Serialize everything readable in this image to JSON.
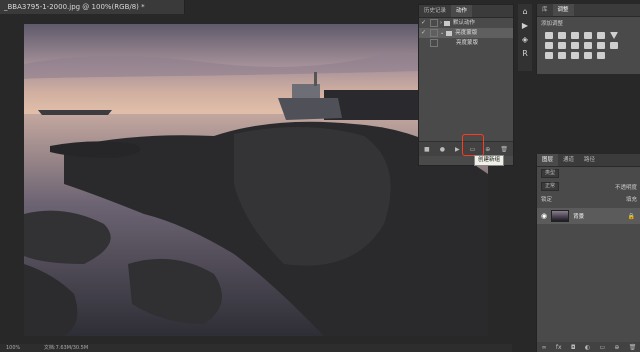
{
  "document": {
    "tab_title": "_BBA3795-1-2000.jpg @ 100%(RGB/8) *",
    "status_text": "文档:7.63M/30.5M",
    "zoom": "100%"
  },
  "actions_panel": {
    "tabs": [
      "历史记录",
      "动作"
    ],
    "active_tab": "动作",
    "rows": [
      {
        "check": "✓",
        "label": "默认动作",
        "selected": false,
        "indent": 0
      },
      {
        "check": "✓",
        "label": "亮度蒙版",
        "selected": true,
        "indent": 1
      },
      {
        "check": "",
        "label": "亮度蒙版",
        "selected": false,
        "indent": 2
      }
    ],
    "toolbar_icons": [
      "stop-icon",
      "record-icon",
      "play-icon",
      "new-set-icon",
      "new-action-icon",
      "delete-icon"
    ],
    "tooltip": "创建新组"
  },
  "right_panel": {
    "tabs": [
      "库",
      "调整"
    ],
    "active_tab": "调整",
    "adj_label": "添加调整"
  },
  "layers_panel": {
    "tabs": [
      "图层",
      "通道",
      "路径"
    ],
    "active_tab": "图层",
    "kind_filter": "类型",
    "blend_mode": "正常",
    "opacity_label": "不透明度",
    "lock_label": "锁定",
    "fill_label": "填充",
    "layer_name": "背景"
  },
  "colors": {
    "accent_highlight": "#ff3b1f",
    "panel_bg": "#4a4a4a",
    "app_bg": "#282828"
  }
}
